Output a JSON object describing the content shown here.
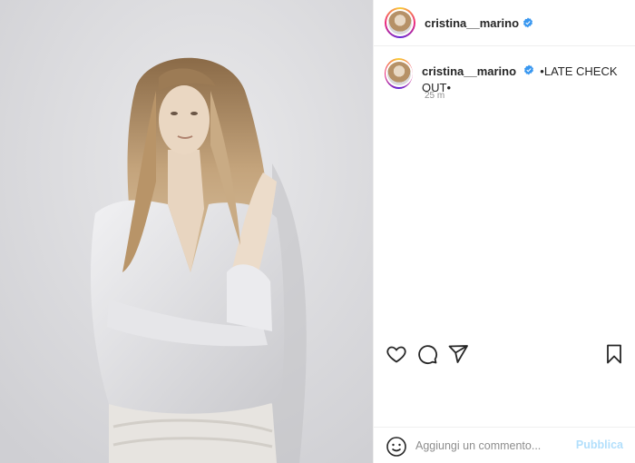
{
  "post": {
    "username": "cristina__marino",
    "caption": "•LATE CHECK OUT•",
    "timestamp": "25 m"
  },
  "photo": {
    "subject": "woman with long wavy blonde hair in white shirt against grey wall"
  },
  "actions": {
    "like": "heart-icon",
    "comment": "comment-bubble-icon",
    "share": "paper-plane-icon",
    "save": "bookmark-icon"
  },
  "comment_box": {
    "placeholder": "Aggiungi un commento...",
    "publish_label": "Pubblica"
  },
  "colors": {
    "verified": "#3897f0",
    "publish_disabled": "#b2dffc",
    "muted_text": "#8e8e8e",
    "border": "#efefef"
  }
}
